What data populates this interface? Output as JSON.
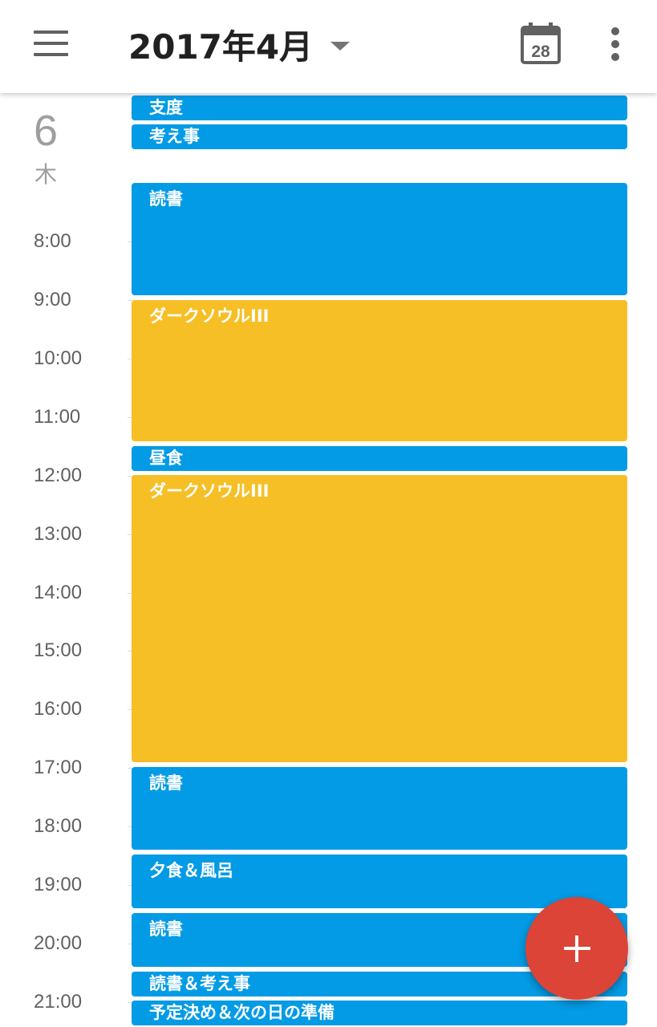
{
  "header": {
    "title": "2017年4月",
    "today_date": "28"
  },
  "day": {
    "number": "6",
    "weekday": "木"
  },
  "hours": [
    "8:00",
    "9:00",
    "10:00",
    "11:00",
    "12:00",
    "13:00",
    "14:00",
    "15:00",
    "16:00",
    "17:00",
    "18:00",
    "19:00",
    "20:00",
    "21:00"
  ],
  "events": [
    {
      "title": "支度",
      "color": "#039be5"
    },
    {
      "title": "考え事",
      "color": "#039be5"
    },
    {
      "title": "読書",
      "color": "#039be5"
    },
    {
      "title": "ダークソウルIII",
      "color": "#f6bf26"
    },
    {
      "title": "昼食",
      "color": "#039be5"
    },
    {
      "title": "ダークソウルIII",
      "color": "#f6bf26"
    },
    {
      "title": "読書",
      "color": "#039be5"
    },
    {
      "title": "夕食＆風呂",
      "color": "#039be5"
    },
    {
      "title": "読書",
      "color": "#039be5"
    },
    {
      "title": "読書＆考え事",
      "color": "#039be5"
    },
    {
      "title": "予定決め＆次の日の準備",
      "color": "#039be5"
    }
  ],
  "colors": {
    "event_blue": "#039be5",
    "event_yellow": "#f6bf26",
    "fab_red": "#db4437"
  },
  "icons": {
    "menu": "hamburger-menu-icon",
    "dropdown": "caret-down-icon",
    "today": "calendar-today-icon",
    "overflow": "more-vert-icon",
    "add": "plus-icon"
  }
}
